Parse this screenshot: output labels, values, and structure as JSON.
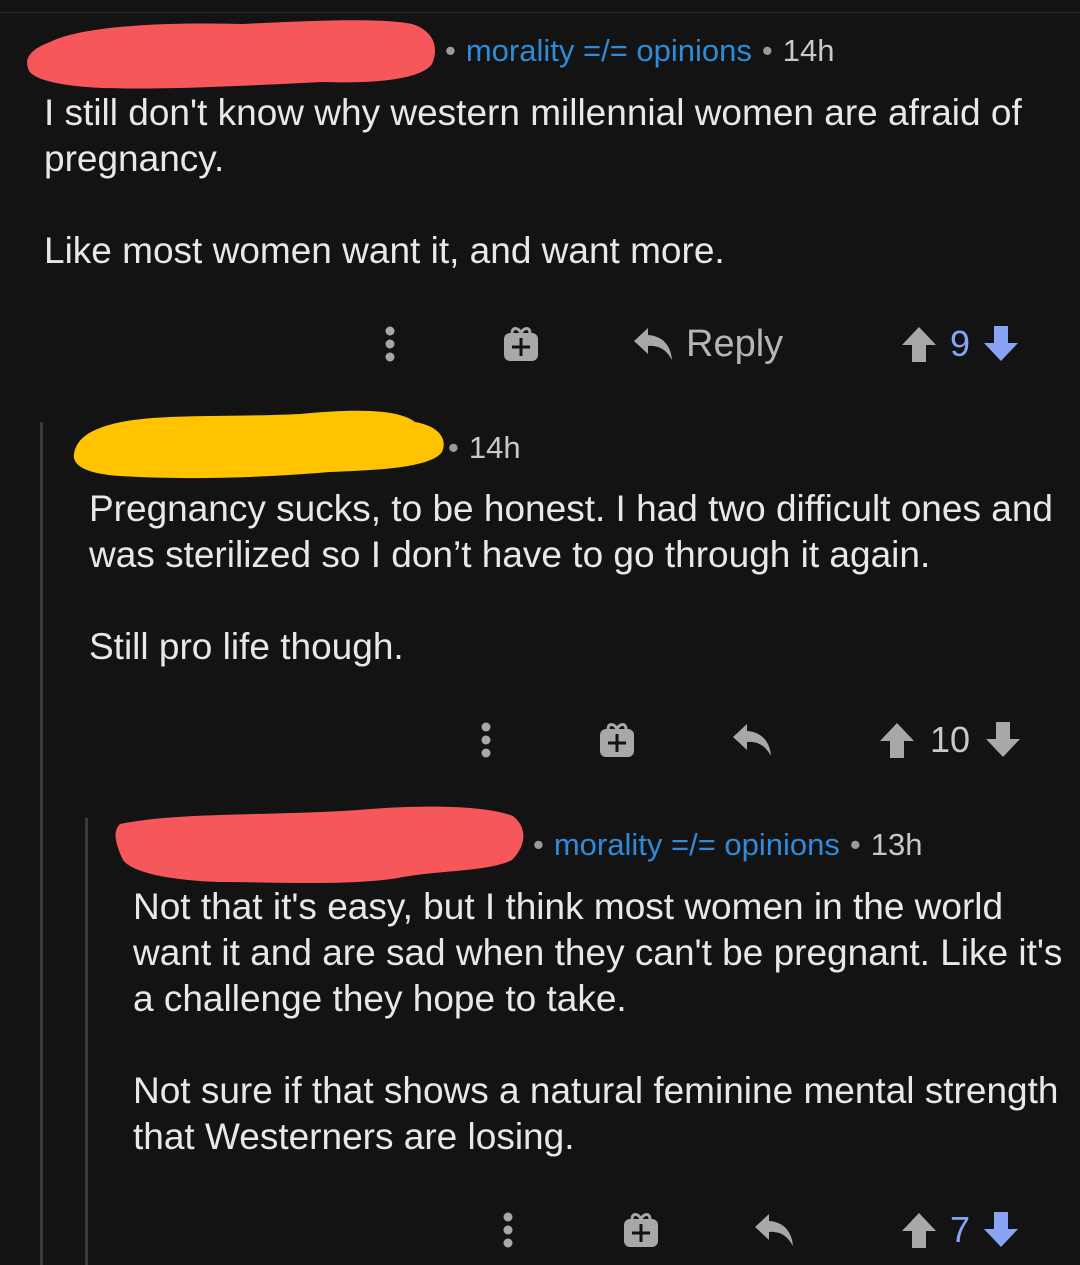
{
  "colors": {
    "background": "#131314",
    "flair": "#2f8ad8",
    "redaction_red": "#f5575a",
    "redaction_yellow": "#ffc300",
    "upvoted": "#8aa3f5",
    "icon_gray": "#a8a8aa",
    "thread_line": "#3a3a3c"
  },
  "comments": [
    {
      "author_redacted": true,
      "redaction_color": "red",
      "flair": "morality =/= opinions",
      "time": "14h",
      "paragraphs": [
        "I still don't know why western millennial women are afraid of pregnancy.",
        "Like most women want it, and want more."
      ],
      "actions": {
        "more_icon": "vertical-dots-icon",
        "award_icon": "gift-icon",
        "reply_icon": "reply-arrow-icon",
        "reply_label": "Reply",
        "score": "9",
        "vote_state": "upvoted"
      }
    },
    {
      "author_redacted": true,
      "redaction_color": "yellow",
      "time": "14h",
      "paragraphs": [
        "Pregnancy sucks, to be honest. I had two difficult ones and was sterilized so I don’t have to go through it again.",
        "Still pro life though."
      ],
      "actions": {
        "more_icon": "vertical-dots-icon",
        "award_icon": "gift-icon",
        "reply_icon": "reply-arrow-icon",
        "score": "10",
        "vote_state": "neutral"
      }
    },
    {
      "author_redacted": true,
      "redaction_color": "red",
      "flair": "morality =/= opinions",
      "time": "13h",
      "paragraphs": [
        "Not that it's easy, but I think most women in the world want it and are sad when they can't be pregnant. Like it's a challenge they hope to take.",
        "Not sure if that shows a natural feminine mental strength that Westerners are losing."
      ],
      "actions": {
        "more_icon": "vertical-dots-icon",
        "award_icon": "gift-icon",
        "reply_icon": "reply-arrow-icon",
        "score": "7",
        "vote_state": "upvoted"
      }
    }
  ]
}
